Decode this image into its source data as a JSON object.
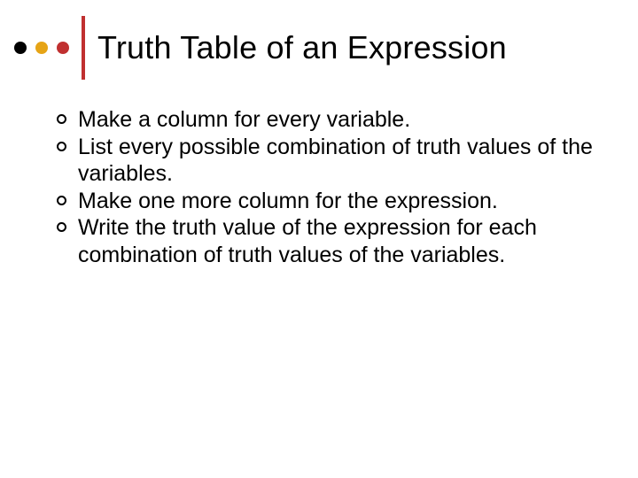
{
  "colors": {
    "dot1": "#000000",
    "dot2": "#e6a416",
    "dot3": "#c03030",
    "divider": "#c03030"
  },
  "title": "Truth Table of an Expression",
  "bullets": [
    "Make a column for every variable.",
    "List every possible combination of truth values of the variables.",
    "Make one more column for the expression.",
    "Write the truth value of the expression for each combination of truth values of the variables."
  ]
}
